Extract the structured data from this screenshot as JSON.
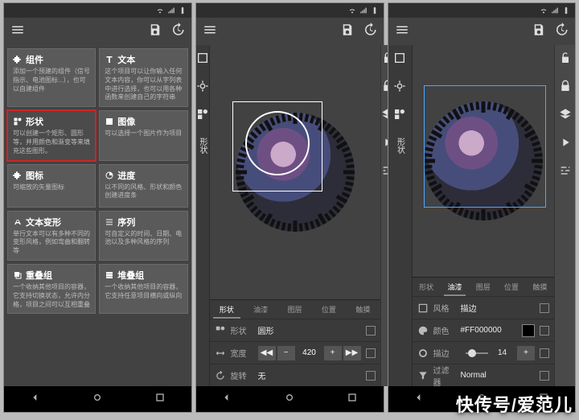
{
  "screen1": {
    "cards": [
      {
        "title": "组件",
        "desc": "添加一个预建的组件（信号指示、电池图标...），也可以自建组件",
        "icon": "puzzle"
      },
      {
        "title": "文本",
        "desc": "这个项目可以让你输入任何文本内容，你可以从字列表中进行选择，也可以用各种函数来创建自己的字符串",
        "icon": "text"
      },
      {
        "title": "形状",
        "desc": "可以创建一个矩形、圆形等，并用颜色和渐变等来填充这些图形。",
        "icon": "shapes",
        "selected": true
      },
      {
        "title": "图像",
        "desc": "可以选择一个图片作为项目",
        "icon": "image"
      },
      {
        "title": "图标",
        "desc": "可缩放的矢量图标",
        "icon": "puzzle"
      },
      {
        "title": "进度",
        "desc": "以不同的风格、形状和颜色创建进度条",
        "icon": "progress"
      },
      {
        "title": "文本变形",
        "desc": "单行文本可以有多种不同的变形风格，例如弯曲和翻转等",
        "icon": "morph"
      },
      {
        "title": "序列",
        "desc": "可自定义的时间、日期、电池以及多种风格的序列",
        "icon": "series"
      },
      {
        "title": "重叠组",
        "desc": "一个收纳其他项目的容器，它支持切换状态，允许内分格，项目之间可以互相重叠",
        "icon": "overlap"
      },
      {
        "title": "堆叠组",
        "desc": "一个收纳其他项目的容器，它支持任意项目横向或纵向",
        "icon": "stack"
      }
    ]
  },
  "screen2": {
    "tooltab_label": "形状",
    "tabs": [
      "形状",
      "油漆",
      "图层",
      "位置",
      "触摸"
    ],
    "active_tab": 0,
    "rows": {
      "shape_label": "形状",
      "shape_value": "圆形",
      "width_label": "宽度",
      "width_value": "420",
      "rotate_label": "旋转",
      "rotate_value": "无"
    }
  },
  "screen3": {
    "tooltab_label": "形状",
    "tabs": [
      "形状",
      "油漆",
      "图层",
      "位置",
      "触摸"
    ],
    "active_tab": 1,
    "rows": {
      "style_label": "风格",
      "style_value": "描边",
      "color_label": "颜色",
      "color_value": "#FF000000",
      "stroke_label": "描边",
      "stroke_value": "14",
      "filter_label": "过滤器",
      "filter_value": "Normal"
    }
  },
  "brand": {
    "a": "快传号",
    "sep": "/",
    "b": "爱范儿"
  }
}
